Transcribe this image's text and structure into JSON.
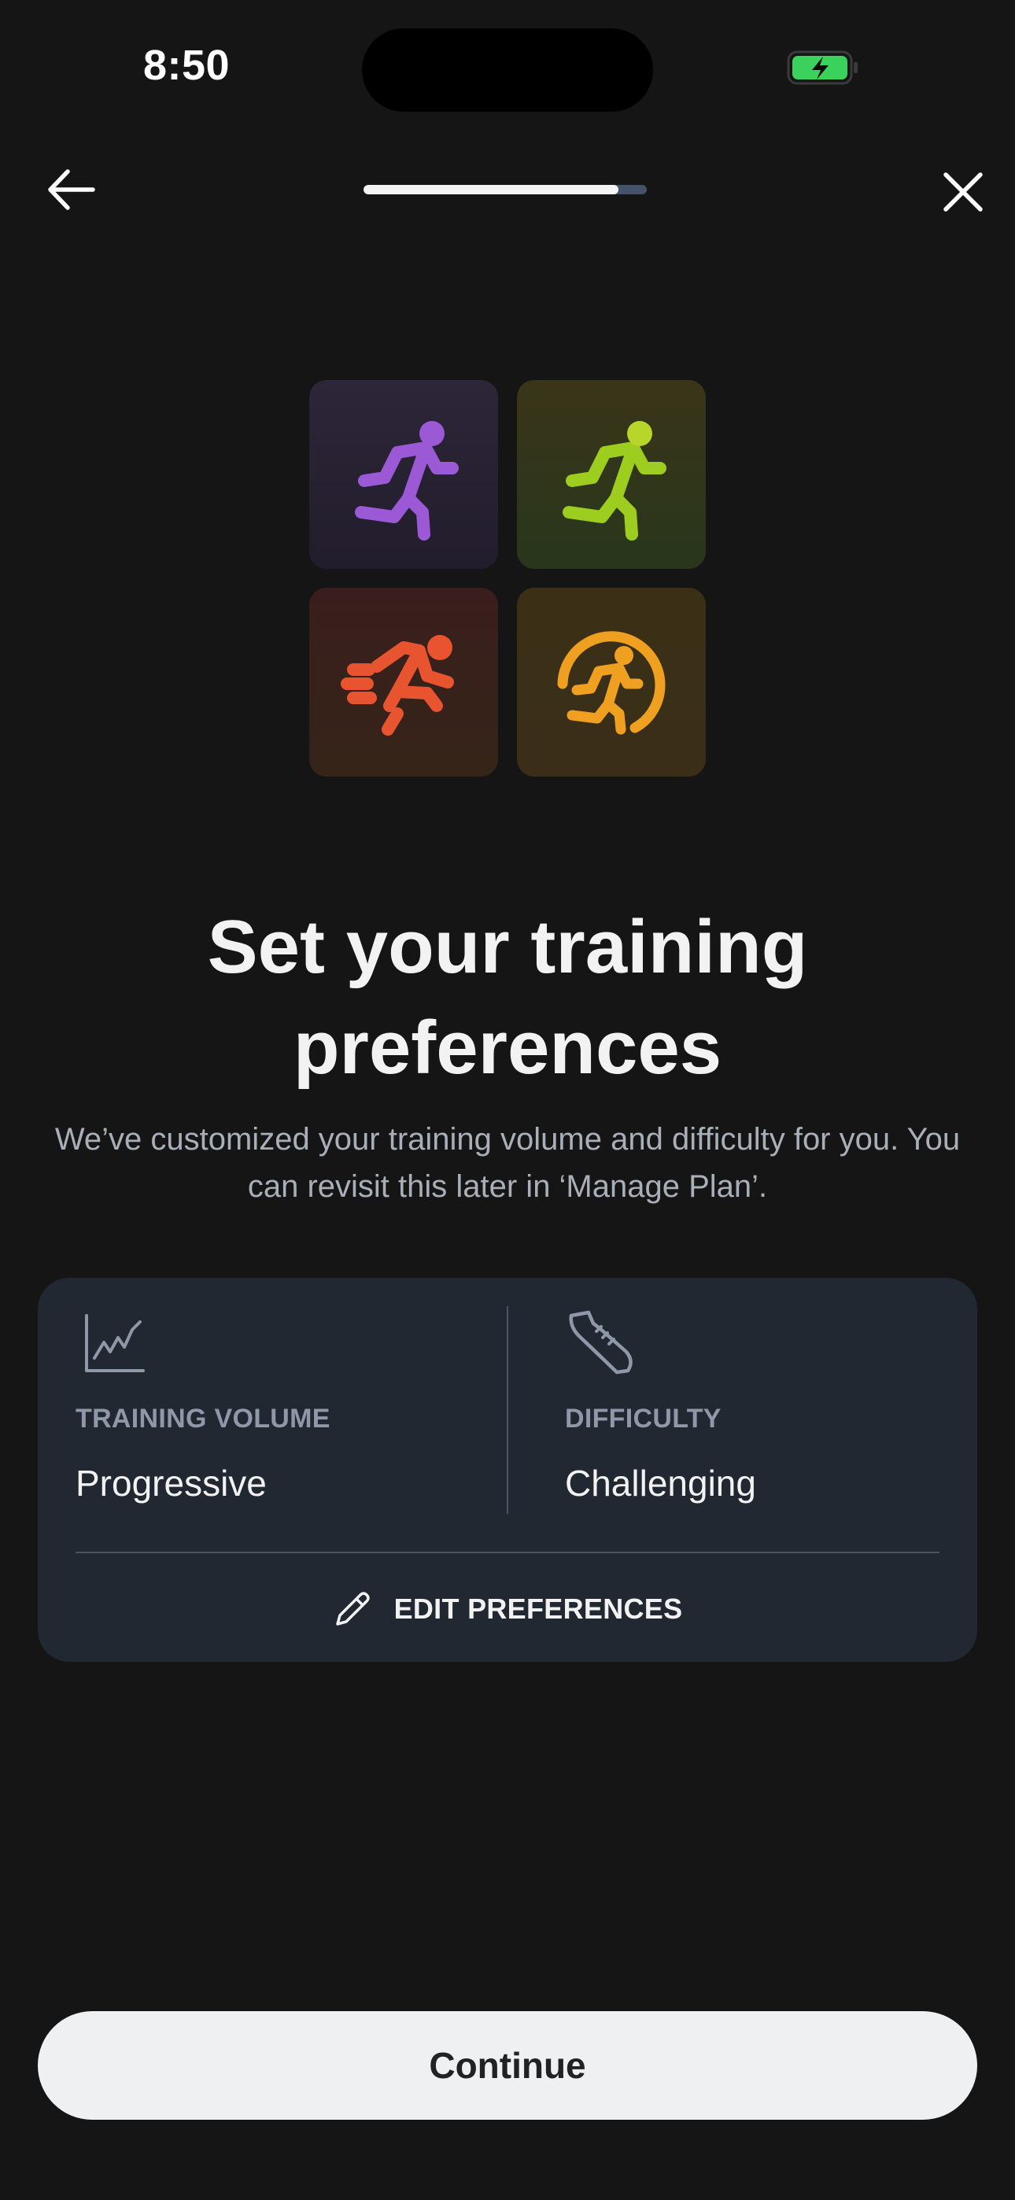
{
  "status_bar": {
    "time": "8:50"
  },
  "nav": {
    "progress": 0.9
  },
  "tiles": [
    {
      "icon": "runner-icon",
      "color": "#9b59d6"
    },
    {
      "icon": "runner-icon",
      "color": "#9ccd1f"
    },
    {
      "icon": "sprinter-icon",
      "color": "#e8542f"
    },
    {
      "icon": "runner-dial-icon",
      "color": "#f0a020"
    }
  ],
  "heading": {
    "title_line1": "Set your training",
    "title_line2": "preferences",
    "subtitle_line1": "We’ve customized your training volume and difficulty for you. You",
    "subtitle_line2": "can revisit this later in ‘Manage Plan’."
  },
  "preferences": {
    "volume_label": "TRAINING VOLUME",
    "volume_value": "Progressive",
    "difficulty_label": "DIFFICULTY",
    "difficulty_value": "Challenging",
    "edit_label": "EDIT PREFERENCES"
  },
  "footer": {
    "continue_label": "Continue"
  },
  "colors": {
    "background": "#151515",
    "card": "#222831",
    "button": "#eef0f2"
  }
}
